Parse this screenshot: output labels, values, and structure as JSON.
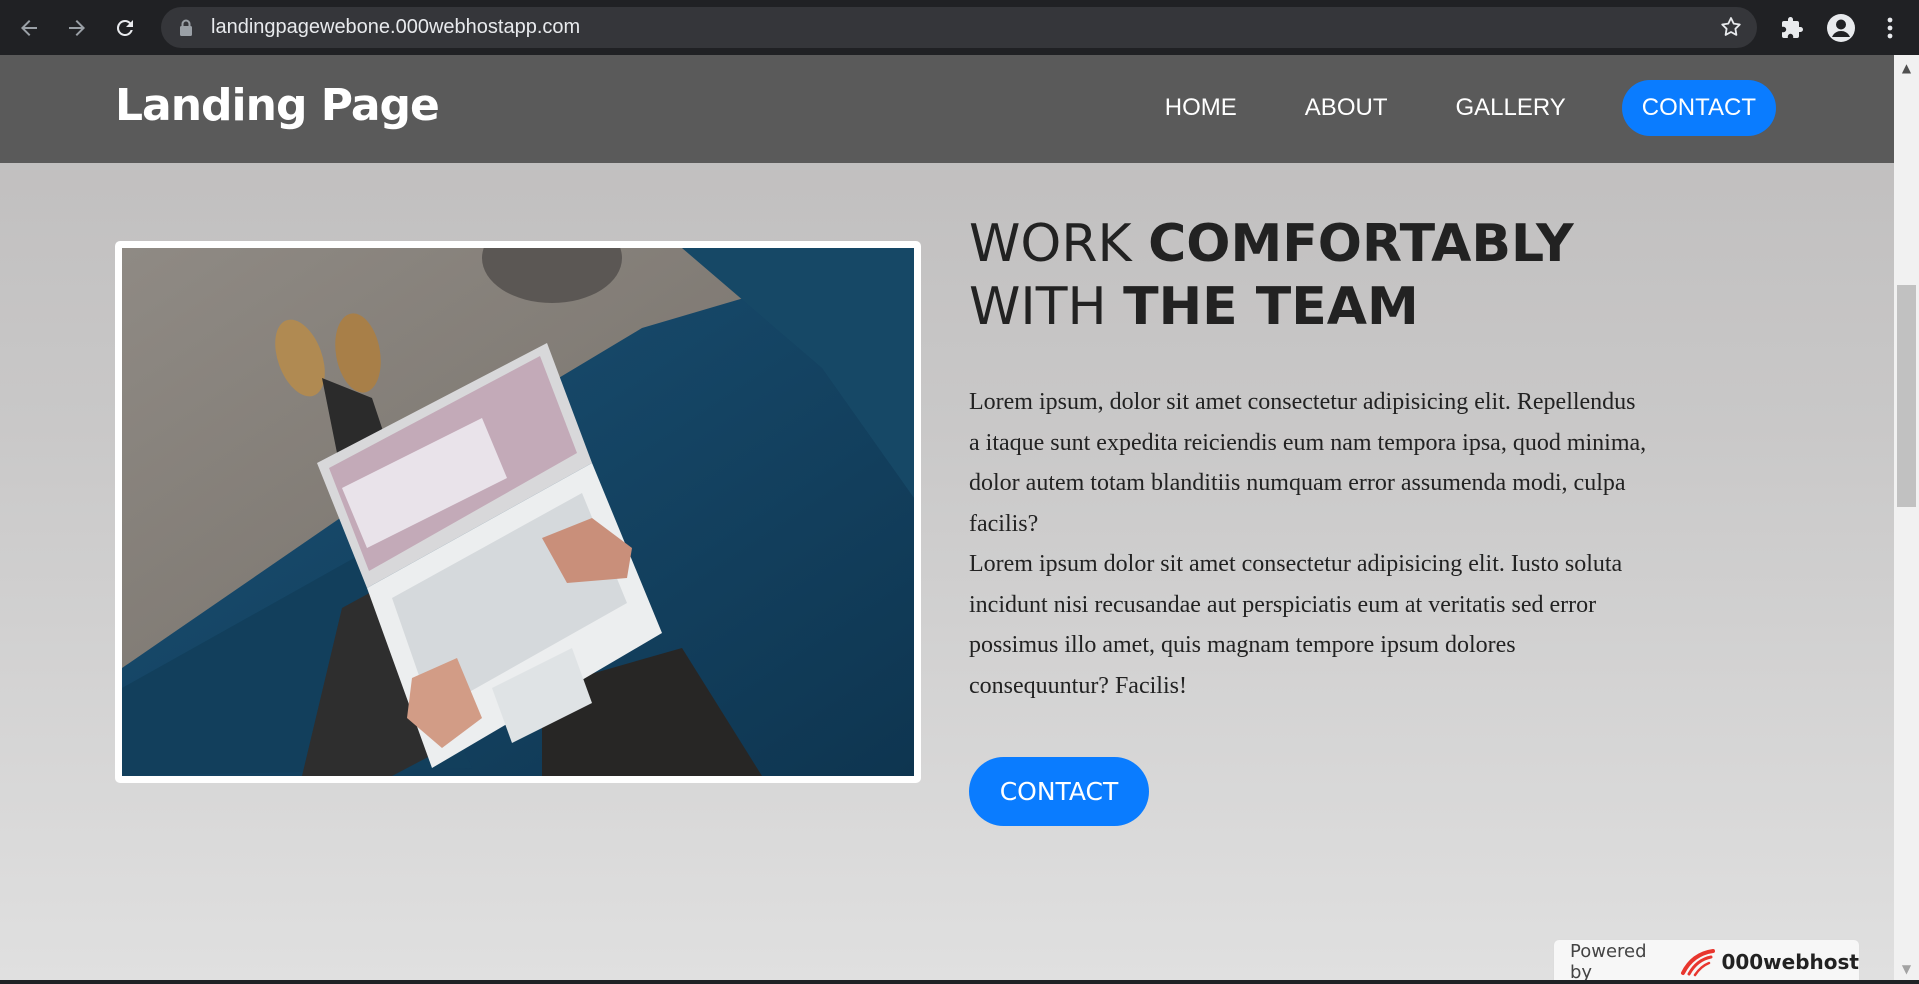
{
  "browser": {
    "url": "landingpagewebone.000webhostapp.com"
  },
  "site": {
    "logo": "Landing Page",
    "nav": [
      {
        "label": "HOME"
      },
      {
        "label": "ABOUT"
      },
      {
        "label": "GALLERY"
      },
      {
        "label": "CONTACT"
      }
    ]
  },
  "hero": {
    "headline_line1_light": "WORK ",
    "headline_line1_bold": "COMFORTABLY",
    "headline_line2_light": "WITH ",
    "headline_line2_bold": "THE TEAM",
    "paragraph1": "Lorem ipsum, dolor sit amet consectetur adipisicing elit. Repellendus a itaque sunt expedita reiciendis eum nam tempora ipsa, quod minima, dolor autem totam blanditiis numquam error assumenda modi, culpa facilis?",
    "paragraph2": "Lorem ipsum dolor sit amet consectetur adipisicing elit. Iusto soluta incidunt nisi recusandae aut perspiciatis eum at veritatis sed error possimus illo amet, quis magnam tempore ipsum dolores consequuntur? Facilis!",
    "cta_label": "CONTACT",
    "image_icon": "laptop-on-couch-photo"
  },
  "footer_badge": {
    "powered_by": "Powered by",
    "brand": "000webhost"
  },
  "colors": {
    "accent": "#0a7cff",
    "header_bg": "#5a5a5a",
    "chrome_bg": "#202124"
  }
}
